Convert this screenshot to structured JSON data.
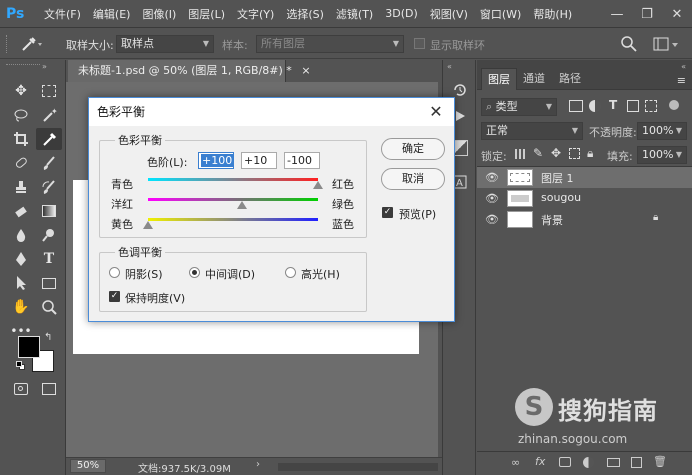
{
  "app": {
    "logo": "Ps"
  },
  "menu": [
    "文件(F)",
    "编辑(E)",
    "图像(I)",
    "图层(L)",
    "文字(Y)",
    "选择(S)",
    "滤镜(T)",
    "3D(D)",
    "视图(V)",
    "窗口(W)",
    "帮助(H)"
  ],
  "window_controls": {
    "minimize": "—",
    "restore": "❐",
    "close": "✕"
  },
  "options_bar": {
    "sample_size_label": "取样大小:",
    "sample_size_value": "取样点",
    "sample_label": "样本:",
    "sample_value": "所有图层",
    "show_ring_label": "显示取样环"
  },
  "document": {
    "tab_title": "未标题-1.psd @ 50% (图层 1, RGB/8#) *",
    "tab_close": "×",
    "zoom": "50%",
    "doc_info": "文档:937.5K/3.09M"
  },
  "layers_panel": {
    "tabs": [
      "图层",
      "通道",
      "路径"
    ],
    "filter_kind": "类型",
    "blend_mode": "正常",
    "opacity_label": "不透明度:",
    "opacity_value": "100%",
    "lock_label": "锁定:",
    "fill_label": "填充:",
    "fill_value": "100%",
    "layers": [
      {
        "name": "图层 1",
        "selected": true
      },
      {
        "name": "sougou",
        "selected": false
      },
      {
        "name": "背景",
        "selected": false,
        "locked": true
      }
    ]
  },
  "dialog": {
    "title": "色彩平衡",
    "close": "✕",
    "balance_group": "色彩平衡",
    "levels_label": "色阶(L):",
    "levels": [
      "+100",
      "+10",
      "-100"
    ],
    "sliders": [
      {
        "left": "青色",
        "right": "红色",
        "value": 100
      },
      {
        "left": "洋红",
        "right": "绿色",
        "value": 10
      },
      {
        "left": "黄色",
        "right": "蓝色",
        "value": -100
      }
    ],
    "tone_group": "色调平衡",
    "tones": [
      "阴影(S)",
      "中间调(D)",
      "高光(H)"
    ],
    "selected_tone": "中间调(D)",
    "preserve_label": "保持明度(V)",
    "preserve_checked": true,
    "ok_label": "确定",
    "cancel_label": "取消",
    "preview_label": "预览(P)",
    "preview_checked": true
  },
  "watermark": {
    "logo": "S",
    "text": "搜狗指南",
    "url": "zhinan.sogou.com"
  }
}
